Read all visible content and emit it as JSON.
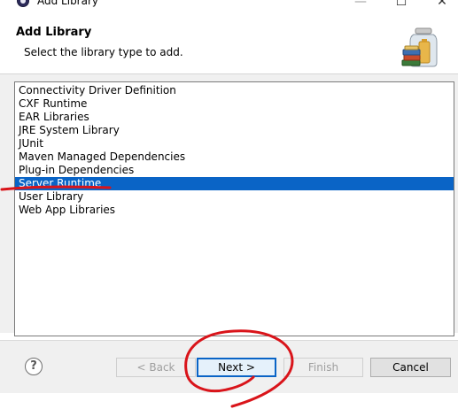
{
  "window": {
    "title": "Add Library",
    "minimize_glyph": "—",
    "maximize_glyph": "☐",
    "close_glyph": "✕"
  },
  "header": {
    "title": "Add Library",
    "description": "Select the library type to add.",
    "icon": "library-jars-icon"
  },
  "library_types": {
    "items": [
      "Connectivity Driver Definition",
      "CXF Runtime",
      "EAR Libraries",
      "JRE System Library",
      "JUnit",
      "Maven Managed Dependencies",
      "Plug-in Dependencies",
      "Server Runtime",
      "User Library",
      "Web App Libraries"
    ],
    "selected": "Server Runtime"
  },
  "footer": {
    "help_glyph": "?",
    "back_label": "< Back",
    "next_label": "Next >",
    "finish_label": "Finish",
    "cancel_label": "Cancel"
  },
  "colors": {
    "selection": "#0a64c6",
    "annotation": "#d9141a"
  }
}
